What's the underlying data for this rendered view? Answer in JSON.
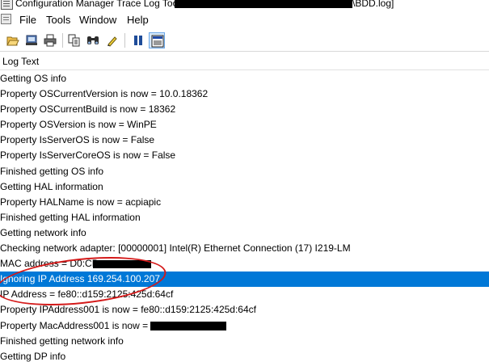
{
  "window": {
    "title_prefix": "Configuration Manager Trace Log Too",
    "title_suffix": "\\BDD.log]"
  },
  "menu": {
    "items": [
      "File",
      "Tools",
      "Window",
      "Help"
    ]
  },
  "toolbar": {
    "buttons": [
      "open-icon",
      "print-preview-icon",
      "print-icon",
      "copy-icon",
      "find-icon",
      "highlight-icon",
      "pause-icon",
      "show-details-icon"
    ]
  },
  "columns": {
    "log_text": "Log Text"
  },
  "log": {
    "rows": [
      "Getting OS info",
      "Property OSCurrentVersion is now = 10.0.18362",
      "Property OSCurrentBuild is now = 18362",
      "Property OSVersion is now = WinPE",
      "Property IsServerOS is now = False",
      "Property IsServerCoreOS is now = False",
      "Finished getting OS info",
      "Getting HAL information",
      "Property HALName is now = acpiapic",
      "Finished getting HAL information",
      "Getting network info",
      "Checking network adapter: [00000001] Intel(R) Ethernet Connection (17) I219-LM",
      "MAC address = D0:CB",
      "Ignoring IP Address 169.254.100.207",
      "IP Address = fe80::d159:2125:425d:64cf",
      "Property IPAddress001 is now = fe80::d159:2125:425d:64cf",
      "Property MacAddress001 is now = D",
      "Finished getting network info",
      "Getting DP info"
    ],
    "selected_row": 13
  },
  "colors": {
    "selection": "#0078d7",
    "annotation": "#d41a1a"
  }
}
